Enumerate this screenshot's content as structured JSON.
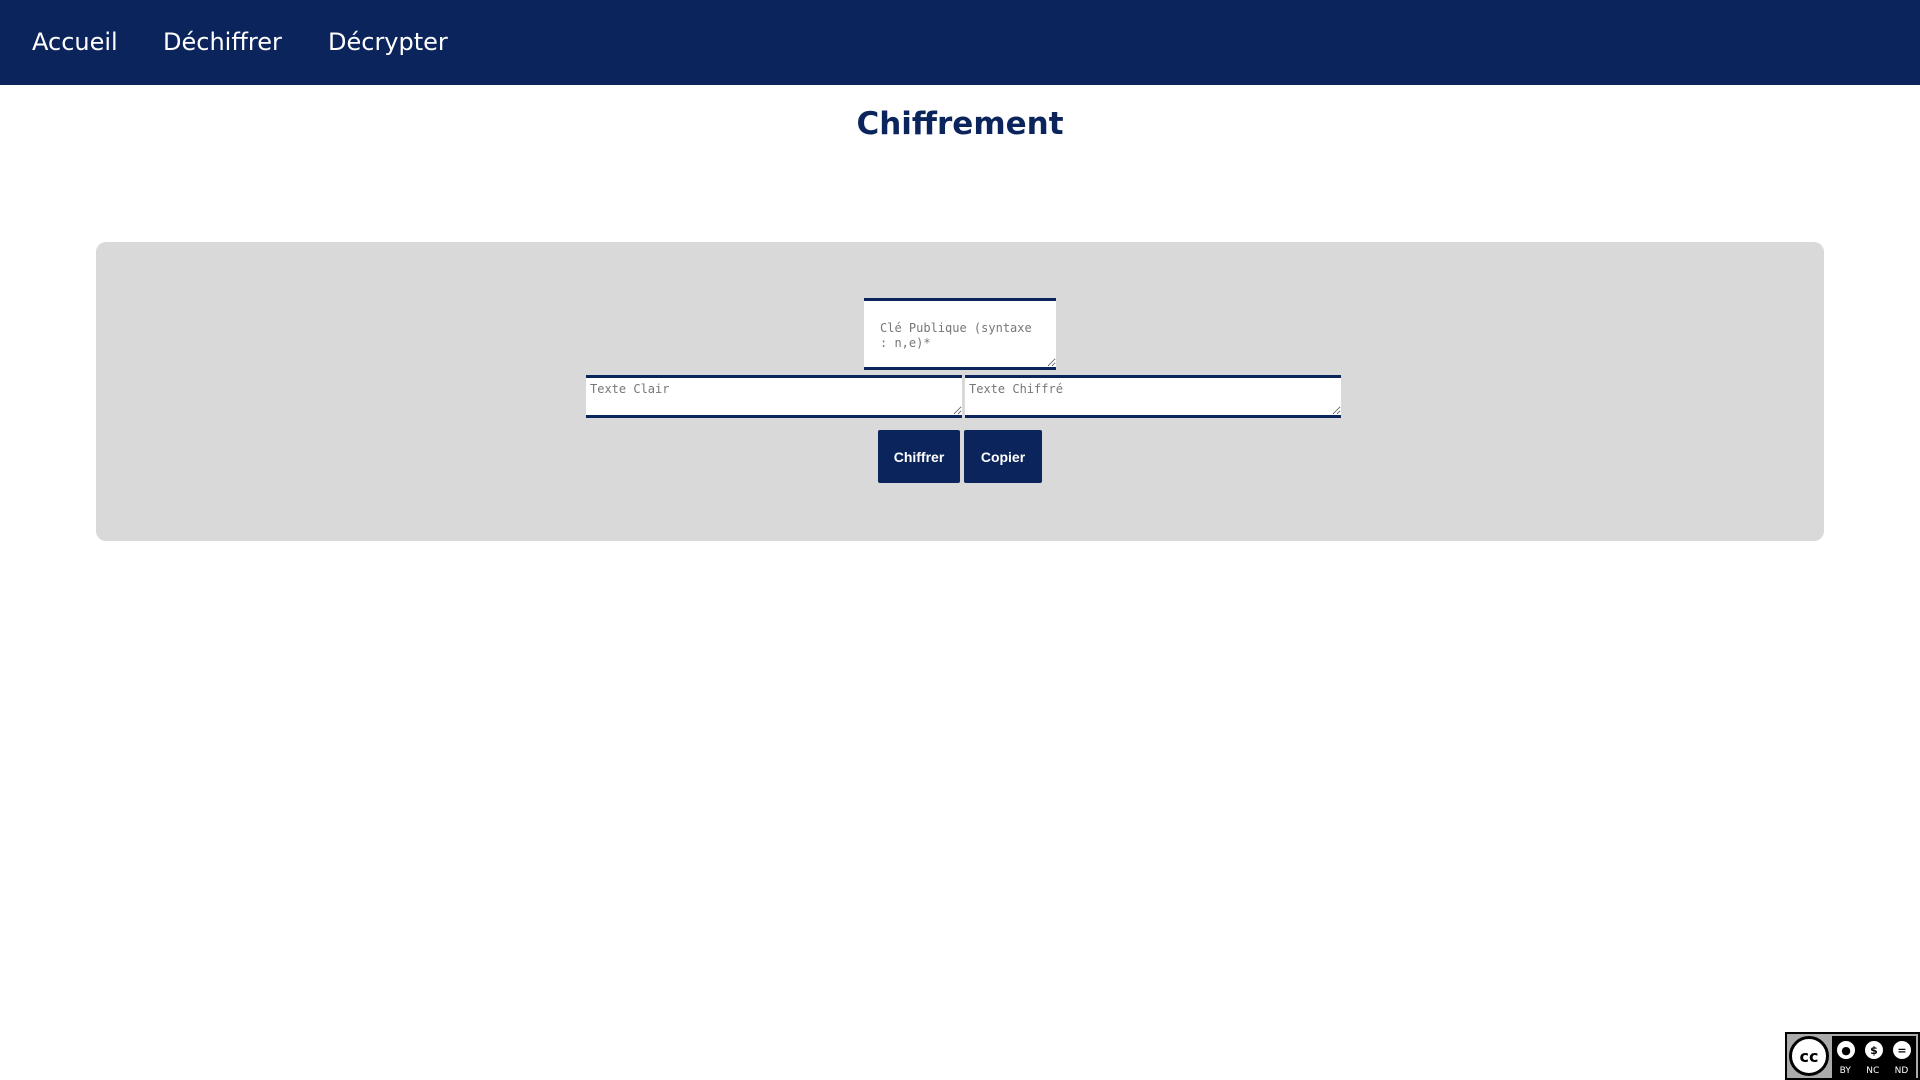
{
  "nav": {
    "items": [
      {
        "label": "Accueil"
      },
      {
        "label": "Déchiffrer"
      },
      {
        "label": "Décrypter"
      }
    ]
  },
  "page": {
    "title": "Chiffrement"
  },
  "form": {
    "key_placeholder": "Clé Publique (syntaxe : n,e)*",
    "plain_placeholder": "Texte Clair",
    "cipher_placeholder": "Texte Chiffré",
    "encrypt_label": "Chiffrer",
    "copy_label": "Copier"
  },
  "license": {
    "logo_text": "cc",
    "labels": [
      "BY",
      "NC",
      "ND"
    ],
    "icons": [
      "attribution-icon",
      "noncommercial-icon",
      "noderivs-icon"
    ]
  },
  "colors": {
    "primary": "#0c245c",
    "panel": "#d9d9d9",
    "background": "#ffffff"
  }
}
